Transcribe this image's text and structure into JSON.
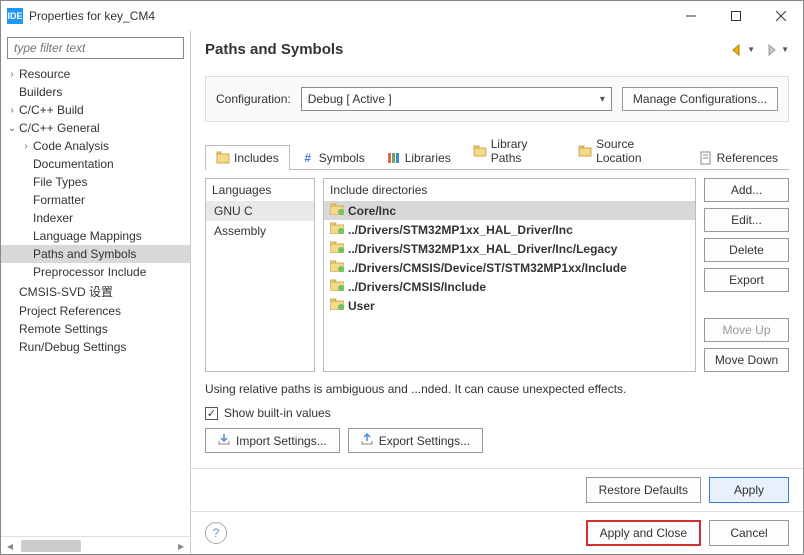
{
  "title": "Properties for key_CM4",
  "filter": {
    "placeholder": "type filter text"
  },
  "tree": {
    "items": [
      {
        "label": "Resource",
        "indent": 0,
        "twist": ">"
      },
      {
        "label": "Builders",
        "indent": 0,
        "twist": ""
      },
      {
        "label": "C/C++ Build",
        "indent": 0,
        "twist": ">"
      },
      {
        "label": "C/C++ General",
        "indent": 0,
        "twist": "v"
      },
      {
        "label": "Code Analysis",
        "indent": 1,
        "twist": ">"
      },
      {
        "label": "Documentation",
        "indent": 1,
        "twist": ""
      },
      {
        "label": "File Types",
        "indent": 1,
        "twist": ""
      },
      {
        "label": "Formatter",
        "indent": 1,
        "twist": ""
      },
      {
        "label": "Indexer",
        "indent": 1,
        "twist": ""
      },
      {
        "label": "Language Mappings",
        "indent": 1,
        "twist": ""
      },
      {
        "label": "Paths and Symbols",
        "indent": 1,
        "twist": "",
        "selected": true
      },
      {
        "label": "Preprocessor Include",
        "indent": 1,
        "twist": ""
      },
      {
        "label": "CMSIS-SVD 设置",
        "indent": 0,
        "twist": ""
      },
      {
        "label": "Project References",
        "indent": 0,
        "twist": ""
      },
      {
        "label": "Remote Settings",
        "indent": 0,
        "twist": ""
      },
      {
        "label": "Run/Debug Settings",
        "indent": 0,
        "twist": ""
      }
    ]
  },
  "page_title": "Paths and Symbols",
  "config": {
    "label": "Configuration:",
    "value": "Debug  [ Active ]",
    "manage": "Manage Configurations..."
  },
  "tabs": {
    "items": [
      {
        "label": "Includes",
        "icon": "includes"
      },
      {
        "label": "Symbols",
        "icon": "hash"
      },
      {
        "label": "Libraries",
        "icon": "books"
      },
      {
        "label": "Library Paths",
        "icon": "folder"
      },
      {
        "label": "Source Location",
        "icon": "folder"
      },
      {
        "label": "References",
        "icon": "ref"
      }
    ]
  },
  "languages": {
    "header": "Languages",
    "items": [
      "GNU C",
      "Assembly"
    ]
  },
  "includes": {
    "header": "Include directories",
    "items": [
      "Core/Inc",
      "../Drivers/STM32MP1xx_HAL_Driver/Inc",
      "../Drivers/STM32MP1xx_HAL_Driver/Inc/Legacy",
      "../Drivers/CMSIS/Device/ST/STM32MP1xx/Include",
      "../Drivers/CMSIS/Include",
      "User"
    ]
  },
  "btncol": {
    "add": "Add...",
    "edit": "Edit...",
    "delete": "Delete",
    "export": "Export",
    "moveup": "Move Up",
    "movedown": "Move Down"
  },
  "warning": "Using relative paths is ambiguous and ...nded. It can cause unexpected effects.",
  "show_builtin": "Show built-in values",
  "import_btn": "Import Settings...",
  "export_btn": "Export Settings...",
  "footer": {
    "restore": "Restore Defaults",
    "apply": "Apply",
    "apply_close": "Apply and Close",
    "cancel": "Cancel"
  }
}
